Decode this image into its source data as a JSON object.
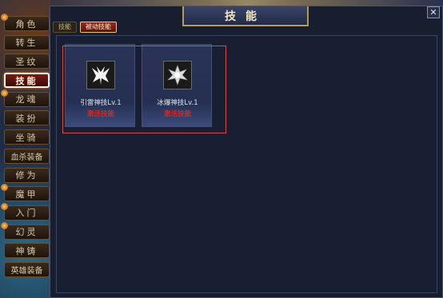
{
  "window": {
    "title": "技能",
    "close_label": "✕"
  },
  "sidebar": {
    "items": [
      {
        "label": "角色",
        "active": false,
        "dot": true
      },
      {
        "label": "转生",
        "active": false,
        "dot": false
      },
      {
        "label": "圣纹",
        "active": false,
        "dot": false
      },
      {
        "label": "技能",
        "active": true,
        "dot": false
      },
      {
        "label": "龙魂",
        "active": false,
        "dot": true
      },
      {
        "label": "装扮",
        "active": false,
        "dot": false
      },
      {
        "label": "坐骑",
        "active": false,
        "dot": false
      },
      {
        "label": "血杀装备",
        "active": false,
        "dot": false
      },
      {
        "label": "修为",
        "active": false,
        "dot": false
      },
      {
        "label": "魔甲",
        "active": false,
        "dot": true
      },
      {
        "label": "入门",
        "active": false,
        "dot": true
      },
      {
        "label": "幻灵",
        "active": false,
        "dot": true
      },
      {
        "label": "神铸",
        "active": false,
        "dot": false
      },
      {
        "label": "英雄装备",
        "active": false,
        "dot": false
      }
    ]
  },
  "tabs": [
    {
      "label": "技能",
      "active": false
    },
    {
      "label": "被动技能",
      "active": true
    }
  ],
  "skills": [
    {
      "name": "引雷神技Lv.1",
      "status": "激活技能",
      "icon": "thunder-claw-icon"
    },
    {
      "name": "冰爆神技Lv.1",
      "status": "激活技能",
      "icon": "ice-burst-icon"
    }
  ],
  "colors": {
    "status_red": "#e0241c",
    "active_tab": "#7a1a14",
    "highlight_box": "#e04848"
  }
}
